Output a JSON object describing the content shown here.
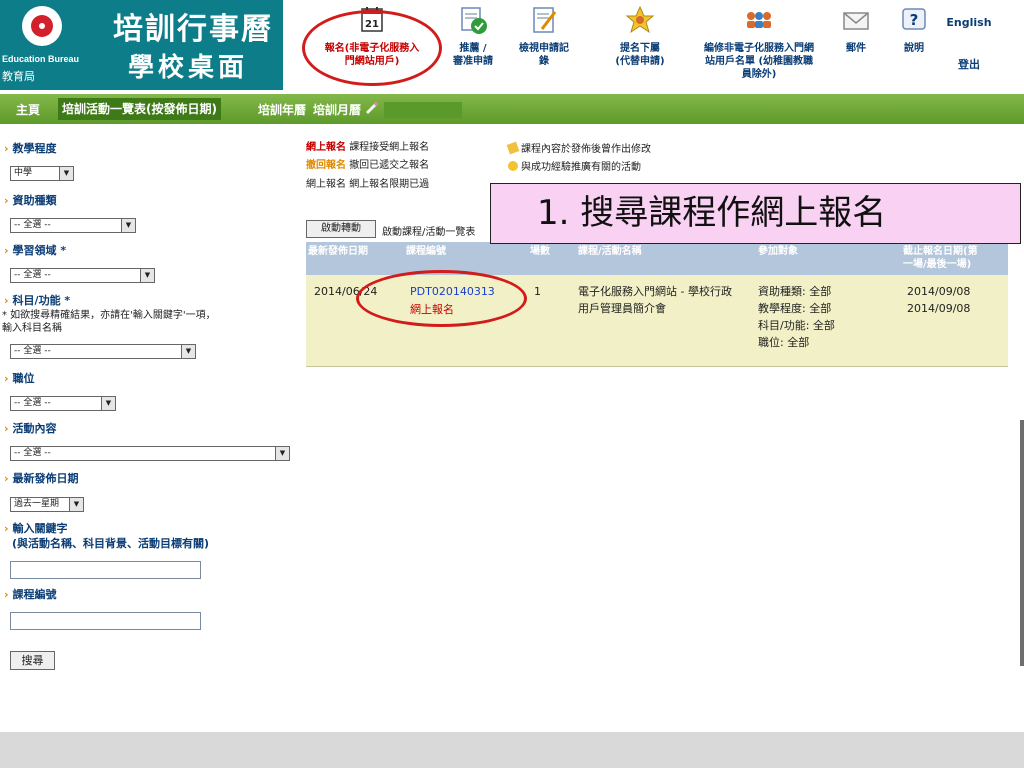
{
  "header": {
    "bureau_en": "Education Bureau",
    "bureau_zh": "教育局",
    "title_line1": "培訓行事曆",
    "title_line2": "學校桌面",
    "calendar_day": "21",
    "nav": {
      "register_line1": "報名(非電子化服務入",
      "register_line2": "門網站用戶)",
      "review_line1": "推薦 /",
      "review_line2": "審准申請",
      "view_line1": "檢視申請記",
      "view_line2": "錄",
      "sub_line1": "提名下屬",
      "sub_line2": "(代替申請)",
      "edit_line1": "編修非電子化服務入門網",
      "edit_line2": "站用戶名單 (幼稚園教職",
      "edit_line3": "員除外)",
      "mail": "郵件",
      "help": "說明",
      "english": "English",
      "logout": "登出"
    }
  },
  "greenbar": {
    "home": "主頁",
    "list": "培訓活動一覽表(按發佈日期)",
    "year": "培訓年曆",
    "month": "培訓月曆"
  },
  "filters": {
    "teaching_level": {
      "label": "教學程度",
      "value": "中學"
    },
    "funding": {
      "label": "資助種類",
      "value": "-- 全選 --"
    },
    "learning_area": {
      "label": "學習領域 *",
      "value": "-- 全選 --"
    },
    "subject": {
      "label": "科目/功能 *",
      "note_line1": "* 如欲搜尋精確結果，亦請在'輸入關鍵字'一項，",
      "note_line2": "輸入科目名稱",
      "value": "-- 全選 --"
    },
    "post": {
      "label": "職位",
      "value": "-- 全選 --"
    },
    "activity_content": {
      "label": "活動內容",
      "value": "-- 全選 --"
    },
    "latest_date": {
      "label": "最新發佈日期",
      "value": "過去一星期"
    },
    "keyword": {
      "label_line1": "輸入關鍵字",
      "label_line2": "(與活動名稱、科目背景、活動目標有關)",
      "value": ""
    },
    "course_code": {
      "label": "課程編號",
      "value": ""
    },
    "search_button": "搜尋"
  },
  "legend": {
    "online_key": "網上報名",
    "online_desc": "課程接受網上報名",
    "withdraw_key": "撤回報名",
    "withdraw_desc": "撤回已遞交之報名",
    "expired_key": "網上報名",
    "expired_desc": "網上報名限期已過",
    "modified_desc": "課程內容於發佈後曾作出修改",
    "promo_desc": "與成功經驗推廣有關的活動"
  },
  "toolbar": {
    "toggle_button": "啟動轉動",
    "toggle_desc": "啟動課程/活動一覽表"
  },
  "step_callout": "1. 搜尋課程作網上報名",
  "table": {
    "headers": {
      "date": "最新發佈日期",
      "code": "課程編號",
      "sessions": "場數",
      "name": "課程/活動名稱",
      "target": "參加對象",
      "deadline_line1": "截止報名日期(第",
      "deadline_line2": "一場/最後一場)"
    },
    "rows": [
      {
        "date": "2014/06/24",
        "code": "PDT020140313",
        "register": "網上報名",
        "sessions": "1",
        "name_line1": "電子化服務入門網站 - 學校行政",
        "name_line2": "用戶管理員簡介會",
        "target_line1": "資助種類: 全部",
        "target_line2": "教學程度: 全部",
        "target_line3": "科目/功能: 全部",
        "target_line4": "職位: 全部",
        "deadline_first": "2014/09/08",
        "deadline_last": "2014/09/08"
      }
    ]
  },
  "colors": {
    "brand_teal": "#0d7d89",
    "nav_green": "#6aa534",
    "annotation_red": "#d21b1b",
    "callout_pink": "#f9d2f3",
    "row_yellow": "#f1f0c7"
  }
}
